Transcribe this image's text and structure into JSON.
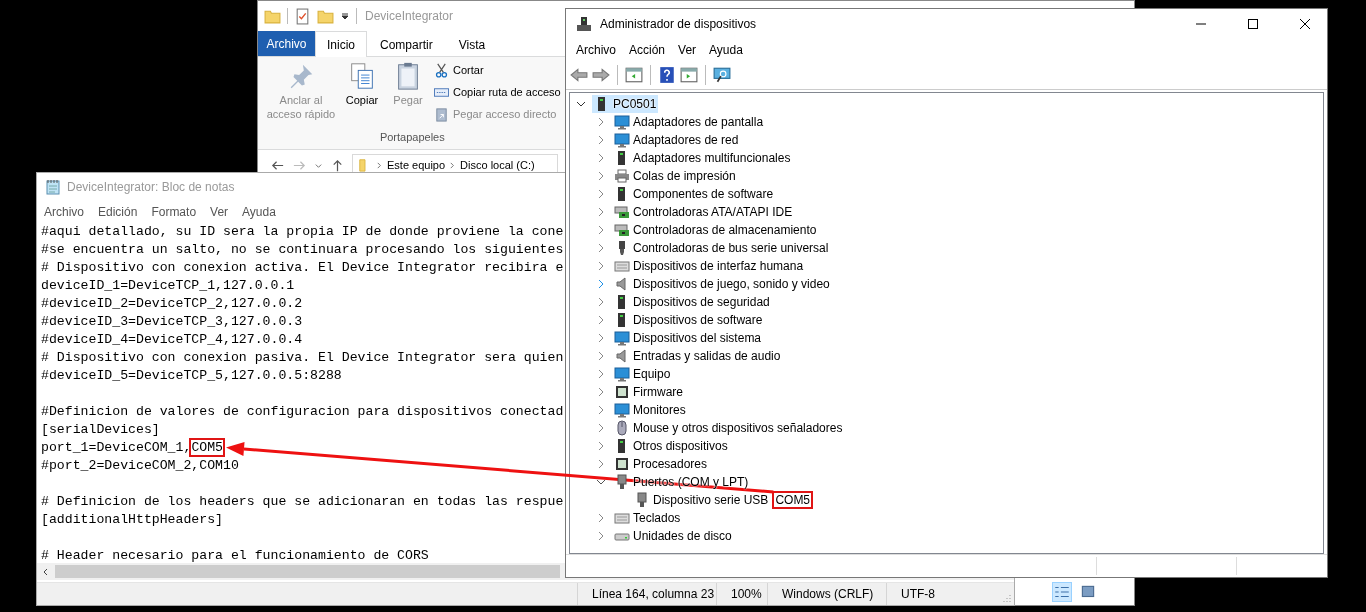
{
  "explorer": {
    "title": "DeviceIntegrator",
    "tabs": [
      {
        "label": "Archivo",
        "kind": "file",
        "selected": false
      },
      {
        "label": "Inicio",
        "kind": "tab",
        "selected": true
      },
      {
        "label": "Compartir",
        "kind": "tab",
        "selected": false
      },
      {
        "label": "Vista",
        "kind": "tab",
        "selected": false
      }
    ],
    "commands": [
      {
        "kind": "large",
        "label": "Anclar al acceso rápido",
        "disabled": true
      },
      {
        "kind": "large",
        "label": "Copiar",
        "disabled": false
      },
      {
        "kind": "large",
        "label": "Pegar",
        "disabled": true
      },
      {
        "kind": "small",
        "label": "Cortar",
        "disabled": false
      },
      {
        "kind": "small",
        "label": "Copiar ruta de acceso",
        "disabled": false
      },
      {
        "kind": "small",
        "label": "Pegar acceso directo",
        "disabled": true
      }
    ],
    "group_label": "Portapapeles",
    "breadcrumb": [
      "Este equipo",
      "Disco local (C:)"
    ],
    "view_buttons": [
      {
        "selected": true
      },
      {
        "selected": false
      }
    ]
  },
  "notepad": {
    "title": "DeviceIntegrator: Bloc de notas",
    "menu": [
      "Archivo",
      "Edición",
      "Formato",
      "Ver",
      "Ayuda"
    ],
    "lines": [
      {
        "kind": "text",
        "text": "#aqui detallado, su ID sera la propia IP de donde proviene la cone"
      },
      {
        "kind": "text",
        "text": "#se encuentra un salto, no se continuara procesando los siguientes"
      },
      {
        "kind": "text",
        "text": "# Dispositivo con conexion activa. El Device Integrator recibira e"
      },
      {
        "kind": "text",
        "text": "deviceID_1=DeviceTCP_1,127.0.0.1"
      },
      {
        "kind": "text",
        "text": "#deviceID_2=DeviceTCP_2,127.0.0.2"
      },
      {
        "kind": "text",
        "text": "#deviceID_3=DeviceTCP_3,127.0.0.3"
      },
      {
        "kind": "text",
        "text": "#deviceID_4=DeviceTCP_4,127.0.0.4"
      },
      {
        "kind": "text",
        "text": "# Dispositivo con conexion pasiva. El Device Integrator sera quien"
      },
      {
        "kind": "text",
        "text": "#deviceID_5=DeviceTCP_5,127.0.0.5:8288"
      },
      {
        "kind": "blank"
      },
      {
        "kind": "text",
        "text": "#Definicion de valores de configuracion para dispositivos conectad"
      },
      {
        "kind": "text",
        "text": "[serialDevices]"
      },
      {
        "kind": "text",
        "text": "port_1=DeviceCOM_1,",
        "highlight": "COM5"
      },
      {
        "kind": "text",
        "text": "#port_2=DeviceCOM_2,COM10"
      },
      {
        "kind": "blank"
      },
      {
        "kind": "text",
        "text": "# Definicion de los headers que se adicionaran en todas las respue"
      },
      {
        "kind": "text",
        "text": "[additionalHttpHeaders]"
      },
      {
        "kind": "blank"
      },
      {
        "kind": "text",
        "text": "# Header necesario para el funcionamiento de CORS"
      }
    ],
    "status": [
      "Línea 164, columna 23",
      "100%",
      "Windows (CRLF)",
      "UTF-8"
    ]
  },
  "device_manager": {
    "title": "Administrador de dispositivos",
    "menu": [
      "Archivo",
      "Acción",
      "Ver",
      "Ayuda"
    ],
    "tree": {
      "label": "PC0501",
      "selected": true,
      "expanded": true,
      "children": [
        {
          "label": "Adaptadores de pantalla",
          "expanded": false,
          "hover": false
        },
        {
          "label": "Adaptadores de red",
          "expanded": false,
          "hover": false
        },
        {
          "label": "Adaptadores multifuncionales",
          "expanded": false,
          "hover": false
        },
        {
          "label": "Colas de impresión",
          "expanded": false,
          "hover": false
        },
        {
          "label": "Componentes de software",
          "expanded": false,
          "hover": false
        },
        {
          "label": "Controladoras ATA/ATAPI IDE",
          "expanded": false,
          "hover": false
        },
        {
          "label": "Controladoras de almacenamiento",
          "expanded": false,
          "hover": false
        },
        {
          "label": "Controladoras de bus serie universal",
          "expanded": false,
          "hover": false
        },
        {
          "label": "Dispositivos de interfaz humana",
          "expanded": false,
          "hover": false
        },
        {
          "label": "Dispositivos de juego, sonido y video",
          "expanded": false,
          "hover": true
        },
        {
          "label": "Dispositivos de seguridad",
          "expanded": false,
          "hover": false
        },
        {
          "label": "Dispositivos de software",
          "expanded": false,
          "hover": false
        },
        {
          "label": "Dispositivos del sistema",
          "expanded": false,
          "hover": false
        },
        {
          "label": "Entradas y salidas de audio",
          "expanded": false,
          "hover": false
        },
        {
          "label": "Equipo",
          "expanded": false,
          "hover": false
        },
        {
          "label": "Firmware",
          "expanded": false,
          "hover": false
        },
        {
          "label": "Monitores",
          "expanded": false,
          "hover": false
        },
        {
          "label": "Mouse y otros dispositivos señaladores",
          "expanded": false,
          "hover": false
        },
        {
          "label": "Otros dispositivos",
          "expanded": false,
          "hover": false
        },
        {
          "label": "Procesadores",
          "expanded": false,
          "hover": false
        },
        {
          "label": "Puertos (COM y LPT)",
          "expanded": true,
          "hover": false,
          "children": [
            {
              "label": "Dispositivo serie USB",
              "highlight": "COM5"
            }
          ]
        },
        {
          "label": "Teclados",
          "expanded": false,
          "hover": false
        },
        {
          "label": "Unidades de disco",
          "expanded": false,
          "hover": false
        }
      ]
    }
  }
}
